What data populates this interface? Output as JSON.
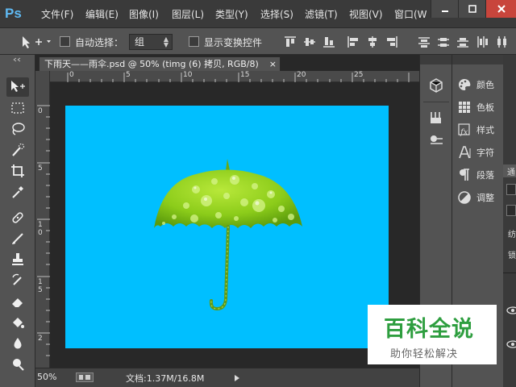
{
  "app": {
    "logo": "Ps"
  },
  "menu": [
    "文件(F)",
    "编辑(E)",
    "图像(I)",
    "图层(L)",
    "类型(Y)",
    "选择(S)",
    "滤镜(T)",
    "视图(V)",
    "窗口(W"
  ],
  "options_bar": {
    "auto_select_label": "自动选择：",
    "auto_select_value": "组",
    "show_transform_label": "显示变换控件"
  },
  "document": {
    "tab_title": "下雨天——雨伞.psd @ 50% (timg (6) 拷贝, RGB/8)",
    "ruler_h": [
      "0",
      "5",
      "10",
      "15",
      "20",
      "25"
    ],
    "ruler_v": [
      "0",
      "5",
      "1\n0",
      "1\n5",
      "2"
    ]
  },
  "status": {
    "zoom": "50%",
    "doc_info": "文档:1.37M/16.8M"
  },
  "panels": {
    "items": [
      "颜色",
      "色板",
      "样式",
      "字符",
      "段落",
      "调整"
    ],
    "edge_labels": [
      "通",
      "纺",
      "锁"
    ]
  },
  "watermark": {
    "title": "百科全说",
    "subtitle": "助你轻松解决"
  },
  "colors": {
    "canvas": "#00bfff",
    "umbrella": "#8ccc1a",
    "ps_blue": "#5fb9f2",
    "close_red": "#c8453c",
    "watermark_green": "#2e9e3f"
  }
}
